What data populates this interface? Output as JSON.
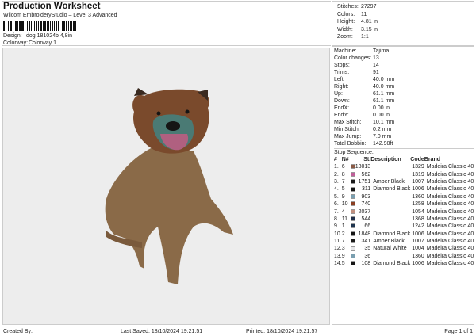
{
  "header": {
    "title": "Production Worksheet",
    "software": "Wilcom EmbroideryStudio – Level 3 Advanced",
    "design_label": "Design:",
    "design": "dog 181024b 4,8in",
    "colorway_label": "Colorway:",
    "colorway": "Colorway 1"
  },
  "stats": [
    {
      "k": "Stitches:",
      "v": "27297"
    },
    {
      "k": "Colors:",
      "v": "11"
    },
    {
      "k": "Height:",
      "v": "4.81 in"
    },
    {
      "k": "Width:",
      "v": "3.15 in"
    },
    {
      "k": "Zoom:",
      "v": "1:1"
    }
  ],
  "info": [
    {
      "k": "Machine:",
      "v": "Tajima"
    },
    {
      "k": "Color changes:",
      "v": "13"
    },
    {
      "k": "Stops:",
      "v": "14"
    },
    {
      "k": "Trims:",
      "v": "91"
    },
    {
      "k": "Left:",
      "v": "40.0 mm"
    },
    {
      "k": "Right:",
      "v": "40.0 mm"
    },
    {
      "k": "Up:",
      "v": "61.1 mm"
    },
    {
      "k": "Down:",
      "v": "61.1 mm"
    },
    {
      "k": "EndX:",
      "v": "0.00 in"
    },
    {
      "k": "EndY:",
      "v": "0.00 in"
    },
    {
      "k": "Max Stitch:",
      "v": "10.1 mm"
    },
    {
      "k": "Min Stitch:",
      "v": "0.2 mm"
    },
    {
      "k": "Max Jump:",
      "v": "7.0 mm"
    },
    {
      "k": "Total Bobbin:",
      "v": "142.98ft"
    }
  ],
  "stop_sequence": {
    "title": "Stop Sequence:",
    "headers": [
      "#",
      "N#",
      "St.",
      "Description",
      "Code",
      "Brand"
    ],
    "rows": [
      {
        "n": "1.",
        "nn": "6",
        "color": "#8a5a45",
        "st": "18013",
        "desc": "",
        "code": "1329",
        "brand": "Madeira Classic 40"
      },
      {
        "n": "2.",
        "nn": "8",
        "color": "#c0609a",
        "st": "562",
        "desc": "",
        "code": "1319",
        "brand": "Madeira Classic 40"
      },
      {
        "n": "3.",
        "nn": "7",
        "color": "#1a1a1a",
        "st": "1751",
        "desc": "Amber Black",
        "code": "1007",
        "brand": "Madeira Classic 40"
      },
      {
        "n": "4.",
        "nn": "5",
        "color": "#151515",
        "st": "311",
        "desc": "Diamond Black",
        "code": "1006",
        "brand": "Madeira Classic 40"
      },
      {
        "n": "5.",
        "nn": "9",
        "color": "#7a9fb0",
        "st": "903",
        "desc": "",
        "code": "1360",
        "brand": "Madeira Classic 40"
      },
      {
        "n": "6.",
        "nn": "10",
        "color": "#8a3e22",
        "st": "740",
        "desc": "",
        "code": "1258",
        "brand": "Madeira Classic 40"
      },
      {
        "n": "7.",
        "nn": "4",
        "color": "#c09080",
        "st": "2037",
        "desc": "",
        "code": "1054",
        "brand": "Madeira Classic 40"
      },
      {
        "n": "8.",
        "nn": "11",
        "color": "#1f2f4a",
        "st": "544",
        "desc": "",
        "code": "1368",
        "brand": "Madeira Classic 40"
      },
      {
        "n": "9.",
        "nn": "1",
        "color": "#1e3550",
        "st": "66",
        "desc": "",
        "code": "1242",
        "brand": "Madeira Classic 40"
      },
      {
        "n": "10.",
        "nn": "2",
        "color": "#151515",
        "st": "1848",
        "desc": "Diamond Black",
        "code": "1006",
        "brand": "Madeira Classic 40"
      },
      {
        "n": "11.",
        "nn": "7",
        "color": "#1a1a1a",
        "st": "341",
        "desc": "Amber Black",
        "code": "1007",
        "brand": "Madeira Classic 40"
      },
      {
        "n": "12.",
        "nn": "3",
        "color": "#e8e8ea",
        "st": "35",
        "desc": "Natural White",
        "code": "1004",
        "brand": "Madeira Classic 40"
      },
      {
        "n": "13.",
        "nn": "9",
        "color": "#7a9fb0",
        "st": "36",
        "desc": "",
        "code": "1360",
        "brand": "Madeira Classic 40"
      },
      {
        "n": "14.",
        "nn": "5",
        "color": "#151515",
        "st": "108",
        "desc": "Diamond Black",
        "code": "1006",
        "brand": "Madeira Classic 40"
      }
    ]
  },
  "footer": {
    "created": "Created By:",
    "saved": "Last Saved: 18/10/2024 19:21:51",
    "printed": "Printed: 18/10/2024 19:21:57",
    "page": "Page 1 of 1"
  }
}
